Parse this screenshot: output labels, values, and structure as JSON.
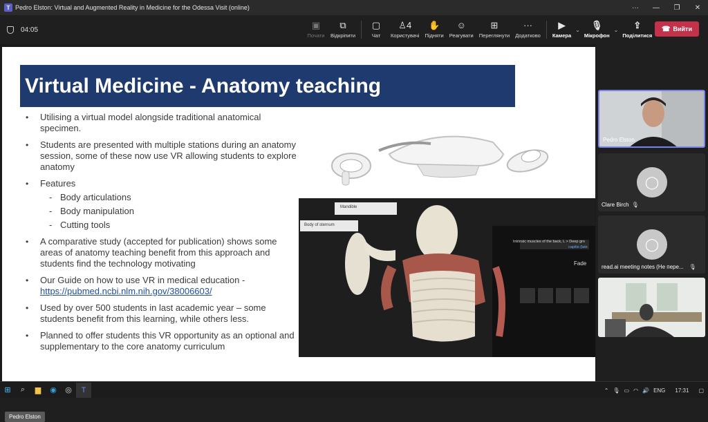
{
  "window": {
    "title": "Pedro Elston: Virtual and Augmented Reality in Medicine for the Odessa Visit (online)",
    "controls": [
      "···",
      "—",
      "❐",
      "✕"
    ]
  },
  "meeting": {
    "timer": "04:05",
    "tools": [
      {
        "label": "Почати",
        "icon": "present-icon",
        "glyph": "▣",
        "disabled": true
      },
      {
        "label": "Відкріпити",
        "icon": "unpin-icon",
        "glyph": "⧉",
        "disabled": false
      },
      {
        "label": "Чат",
        "icon": "chat-icon",
        "glyph": "💬",
        "disabled": false
      },
      {
        "label": "Користувачі",
        "icon": "people-icon",
        "glyph": "👤4",
        "disabled": false
      },
      {
        "label": "Підняти",
        "icon": "raise-hand-icon",
        "glyph": "✋",
        "disabled": false
      },
      {
        "label": "Реагувати",
        "icon": "react-icon",
        "glyph": "☺",
        "disabled": false
      },
      {
        "label": "Переглянути",
        "icon": "view-icon",
        "glyph": "⊞",
        "disabled": false
      },
      {
        "label": "Додатково",
        "icon": "more-icon",
        "glyph": "···",
        "disabled": false
      }
    ],
    "camera_label": "Камера",
    "mic_label": "Мікрофон",
    "share_label": "Поділитися",
    "leave_label": "Вийти"
  },
  "slide": {
    "title": "Virtual Medicine - Anatomy teaching",
    "bullets": [
      "Utilising a virtual model alongside traditional anatomical specimen.",
      "Students are presented with multiple stations during an anatomy session, some of these now use VR allowing students to explore anatomy",
      "Features"
    ],
    "features": [
      "Body articulations",
      "Body manipulation",
      "Cutting tools"
    ],
    "bullets2": [
      "A comparative study (accepted for publication) shows some areas of anatomy teaching benefit from this approach and students find the technology motivating"
    ],
    "guide_text": "Our Guide on how to use VR in medical education -",
    "guide_link": "https://pubmed.ncbi.nlm.nih.gov/38006603/",
    "bullets3": [
      "Used by over 500 students in last academic year – some students benefit from this learning, while others less.",
      "Planned to offer students this VR opportunity as an optional and supplementary to the core anatomy curriculum"
    ],
    "anatomy_labels": {
      "mandible": "Mandible",
      "sternum": "Body of sternum",
      "panel_title": "Intrinsic muscles of the back, L > Deep gro",
      "panel_sub": "capitis (late",
      "fade": "Fade"
    }
  },
  "presenter_tag": "Pedro Elston",
  "participants": [
    {
      "name": "Pedro Elston",
      "active": true,
      "type": "video",
      "muted": false
    },
    {
      "name": "Clare Birch",
      "active": false,
      "type": "avatar",
      "muted": true
    },
    {
      "name": "read.ai meeting notes (Не пере...",
      "active": false,
      "type": "avatar",
      "muted": true
    },
    {
      "name": "",
      "active": false,
      "type": "room",
      "muted": false
    }
  ],
  "taskbar": {
    "lang": "ENG",
    "time": "17:31"
  }
}
